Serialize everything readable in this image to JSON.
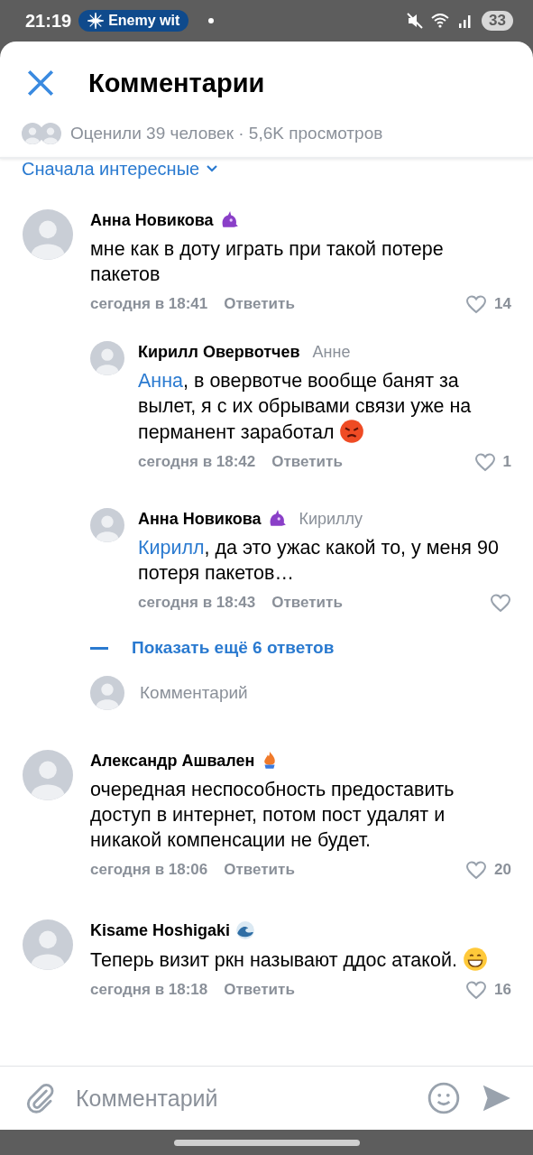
{
  "status_bar": {
    "time": "21:19",
    "media_chip": "Enemy wit",
    "battery": "33"
  },
  "header": {
    "title": "Комментарии",
    "stats": "Оценили 39 человек · 5,6K просмотров"
  },
  "sort": {
    "label": "Сначала интересные"
  },
  "comments": [
    {
      "author": "Анна Новикова",
      "badge": {
        "kind": "monster"
      },
      "text": "мне как в доту играть при такой потере пакетов",
      "time": "сегодня в 18:41",
      "reply_label": "Ответить",
      "likes": "14",
      "replies": [
        {
          "author": "Кирилл Овервотчев",
          "reply_to": "Анне",
          "mention": "Анна",
          "text": ", в овервотче вообще банят за вылет, я с их обрывами связи уже на перманент заработал",
          "emoji": {
            "kind": "angry"
          },
          "time": "сегодня в 18:42",
          "reply_label": "Ответить",
          "likes": "1"
        },
        {
          "author": "Анна Новикова",
          "badge": {
            "kind": "monster"
          },
          "reply_to": "Кириллу",
          "mention": "Кирилл",
          "text": ", да это ужас какой то, у меня 90 потеря пакетов…",
          "time": "сегодня в 18:43",
          "reply_label": "Ответить"
        }
      ],
      "show_more": "Показать ещё 6 ответов",
      "reply_placeholder": "Комментарий"
    },
    {
      "author": "Александр Ашвален",
      "badge": {
        "kind": "flame"
      },
      "text": "очередная неспособность предоставить доступ в интернет, потом пост удалят и никакой компенсации не будет.",
      "time": "сегодня в 18:06",
      "reply_label": "Ответить",
      "likes": "20"
    },
    {
      "author": "Kisame Hoshigaki",
      "badge": {
        "kind": "wave"
      },
      "text": "Теперь визит ркн называют ддос атакой.",
      "emoji": {
        "kind": "grin"
      },
      "time": "сегодня в 18:18",
      "reply_label": "Ответить",
      "likes": "16"
    }
  ],
  "composer": {
    "placeholder": "Комментарий"
  }
}
